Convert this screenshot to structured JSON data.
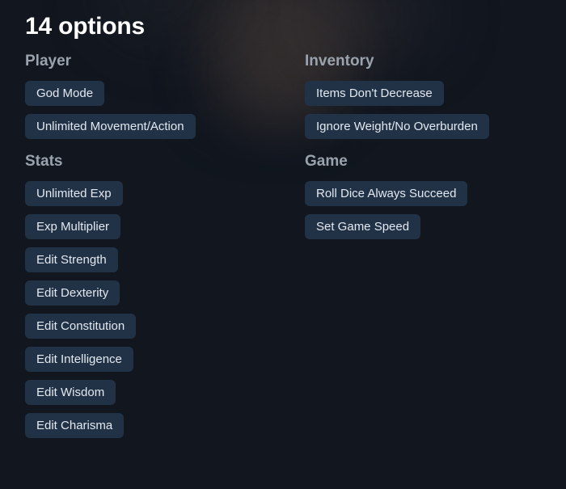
{
  "title": "14 options",
  "colors": {
    "background": "#11161f",
    "button_bg": "#223246",
    "button_text": "#e2e8f0",
    "title_text": "#ffffff",
    "section_title_text": "#9aa3ad"
  },
  "columns": [
    {
      "name": "left",
      "sections": [
        {
          "title": "Player",
          "options": [
            "God Mode",
            "Unlimited Movement/Action"
          ]
        },
        {
          "title": "Stats",
          "options": [
            "Unlimited Exp",
            "Exp Multiplier",
            "Edit Strength",
            "Edit Dexterity",
            "Edit Constitution",
            "Edit Intelligence",
            "Edit Wisdom",
            "Edit Charisma"
          ]
        }
      ]
    },
    {
      "name": "right",
      "sections": [
        {
          "title": "Inventory",
          "options": [
            "Items Don't Decrease",
            "Ignore Weight/No Overburden"
          ]
        },
        {
          "title": "Game",
          "options": [
            "Roll Dice Always Succeed",
            "Set Game Speed"
          ]
        }
      ]
    }
  ]
}
